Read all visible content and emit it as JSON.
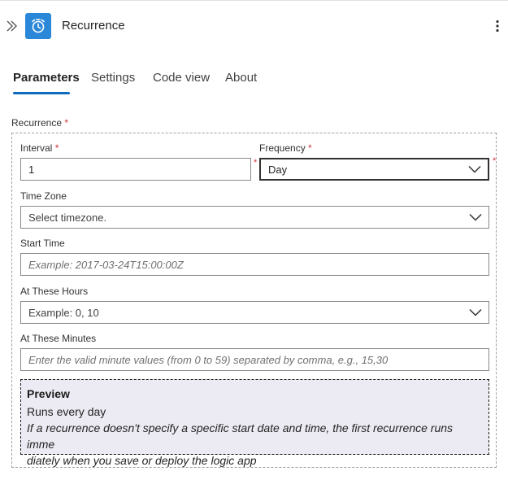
{
  "header": {
    "title": "Recurrence",
    "collapse_icon": "double-chevron-right-icon",
    "app_icon": "alarm-clock-icon",
    "more_icon": "more-vertical-icon"
  },
  "tabs": [
    {
      "label": "Parameters",
      "active": true
    },
    {
      "label": "Settings",
      "active": false
    },
    {
      "label": "Code view",
      "active": false
    },
    {
      "label": "About",
      "active": false
    }
  ],
  "form": {
    "section_label": "Recurrence",
    "required_mark": "*",
    "interval": {
      "label": "Interval",
      "value": "1"
    },
    "frequency": {
      "label": "Frequency",
      "value": "Day"
    },
    "time_zone": {
      "label": "Time Zone",
      "placeholder": "Select timezone."
    },
    "start_time": {
      "label": "Start Time",
      "placeholder": "Example: 2017-03-24T15:00:00Z"
    },
    "at_these_hours": {
      "label": "At These Hours",
      "placeholder": "Example: 0, 10"
    },
    "at_these_minutes": {
      "label": "At These Minutes",
      "placeholder": "Enter the valid minute values (from 0 to 59) separated by comma, e.g., 15,30"
    }
  },
  "preview": {
    "title": "Preview",
    "summary": "Runs every day",
    "note_line1": "If a recurrence doesn't specify a specific start date and time, the first recurrence runs imme",
    "note_line2": "diately when you save or deploy the logic app"
  },
  "colors": {
    "accent": "#0f6cbd",
    "app_icon_bg": "#2b88d8",
    "required": "#d13438",
    "preview_bg": "#eceaf2"
  }
}
